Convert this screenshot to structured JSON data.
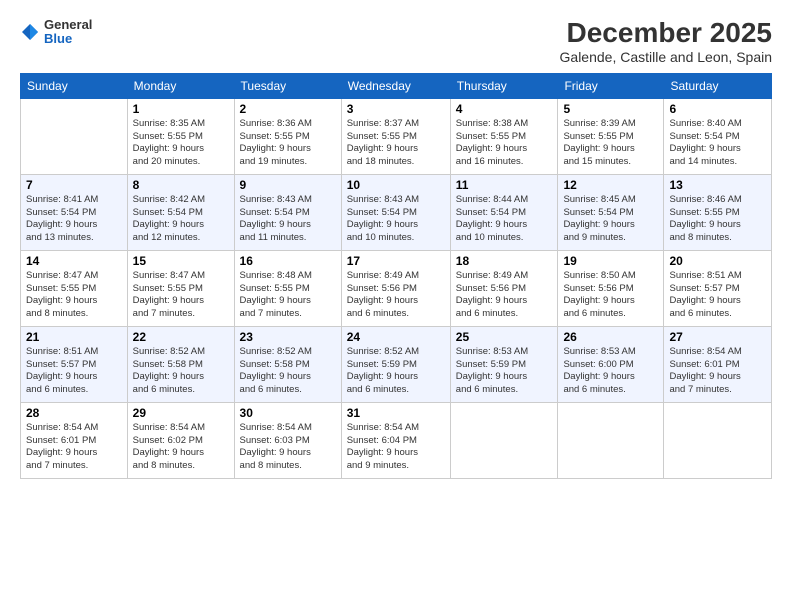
{
  "logo": {
    "general": "General",
    "blue": "Blue"
  },
  "title": "December 2025",
  "location": "Galende, Castille and Leon, Spain",
  "weekdays": [
    "Sunday",
    "Monday",
    "Tuesday",
    "Wednesday",
    "Thursday",
    "Friday",
    "Saturday"
  ],
  "weeks": [
    [
      {
        "day": "",
        "info": ""
      },
      {
        "day": "1",
        "info": "Sunrise: 8:35 AM\nSunset: 5:55 PM\nDaylight: 9 hours\nand 20 minutes."
      },
      {
        "day": "2",
        "info": "Sunrise: 8:36 AM\nSunset: 5:55 PM\nDaylight: 9 hours\nand 19 minutes."
      },
      {
        "day": "3",
        "info": "Sunrise: 8:37 AM\nSunset: 5:55 PM\nDaylight: 9 hours\nand 18 minutes."
      },
      {
        "day": "4",
        "info": "Sunrise: 8:38 AM\nSunset: 5:55 PM\nDaylight: 9 hours\nand 16 minutes."
      },
      {
        "day": "5",
        "info": "Sunrise: 8:39 AM\nSunset: 5:55 PM\nDaylight: 9 hours\nand 15 minutes."
      },
      {
        "day": "6",
        "info": "Sunrise: 8:40 AM\nSunset: 5:54 PM\nDaylight: 9 hours\nand 14 minutes."
      }
    ],
    [
      {
        "day": "7",
        "info": "Sunrise: 8:41 AM\nSunset: 5:54 PM\nDaylight: 9 hours\nand 13 minutes."
      },
      {
        "day": "8",
        "info": "Sunrise: 8:42 AM\nSunset: 5:54 PM\nDaylight: 9 hours\nand 12 minutes."
      },
      {
        "day": "9",
        "info": "Sunrise: 8:43 AM\nSunset: 5:54 PM\nDaylight: 9 hours\nand 11 minutes."
      },
      {
        "day": "10",
        "info": "Sunrise: 8:43 AM\nSunset: 5:54 PM\nDaylight: 9 hours\nand 10 minutes."
      },
      {
        "day": "11",
        "info": "Sunrise: 8:44 AM\nSunset: 5:54 PM\nDaylight: 9 hours\nand 10 minutes."
      },
      {
        "day": "12",
        "info": "Sunrise: 8:45 AM\nSunset: 5:54 PM\nDaylight: 9 hours\nand 9 minutes."
      },
      {
        "day": "13",
        "info": "Sunrise: 8:46 AM\nSunset: 5:55 PM\nDaylight: 9 hours\nand 8 minutes."
      }
    ],
    [
      {
        "day": "14",
        "info": "Sunrise: 8:47 AM\nSunset: 5:55 PM\nDaylight: 9 hours\nand 8 minutes."
      },
      {
        "day": "15",
        "info": "Sunrise: 8:47 AM\nSunset: 5:55 PM\nDaylight: 9 hours\nand 7 minutes."
      },
      {
        "day": "16",
        "info": "Sunrise: 8:48 AM\nSunset: 5:55 PM\nDaylight: 9 hours\nand 7 minutes."
      },
      {
        "day": "17",
        "info": "Sunrise: 8:49 AM\nSunset: 5:56 PM\nDaylight: 9 hours\nand 6 minutes."
      },
      {
        "day": "18",
        "info": "Sunrise: 8:49 AM\nSunset: 5:56 PM\nDaylight: 9 hours\nand 6 minutes."
      },
      {
        "day": "19",
        "info": "Sunrise: 8:50 AM\nSunset: 5:56 PM\nDaylight: 9 hours\nand 6 minutes."
      },
      {
        "day": "20",
        "info": "Sunrise: 8:51 AM\nSunset: 5:57 PM\nDaylight: 9 hours\nand 6 minutes."
      }
    ],
    [
      {
        "day": "21",
        "info": "Sunrise: 8:51 AM\nSunset: 5:57 PM\nDaylight: 9 hours\nand 6 minutes."
      },
      {
        "day": "22",
        "info": "Sunrise: 8:52 AM\nSunset: 5:58 PM\nDaylight: 9 hours\nand 6 minutes."
      },
      {
        "day": "23",
        "info": "Sunrise: 8:52 AM\nSunset: 5:58 PM\nDaylight: 9 hours\nand 6 minutes."
      },
      {
        "day": "24",
        "info": "Sunrise: 8:52 AM\nSunset: 5:59 PM\nDaylight: 9 hours\nand 6 minutes."
      },
      {
        "day": "25",
        "info": "Sunrise: 8:53 AM\nSunset: 5:59 PM\nDaylight: 9 hours\nand 6 minutes."
      },
      {
        "day": "26",
        "info": "Sunrise: 8:53 AM\nSunset: 6:00 PM\nDaylight: 9 hours\nand 6 minutes."
      },
      {
        "day": "27",
        "info": "Sunrise: 8:54 AM\nSunset: 6:01 PM\nDaylight: 9 hours\nand 7 minutes."
      }
    ],
    [
      {
        "day": "28",
        "info": "Sunrise: 8:54 AM\nSunset: 6:01 PM\nDaylight: 9 hours\nand 7 minutes."
      },
      {
        "day": "29",
        "info": "Sunrise: 8:54 AM\nSunset: 6:02 PM\nDaylight: 9 hours\nand 8 minutes."
      },
      {
        "day": "30",
        "info": "Sunrise: 8:54 AM\nSunset: 6:03 PM\nDaylight: 9 hours\nand 8 minutes."
      },
      {
        "day": "31",
        "info": "Sunrise: 8:54 AM\nSunset: 6:04 PM\nDaylight: 9 hours\nand 9 minutes."
      },
      {
        "day": "",
        "info": ""
      },
      {
        "day": "",
        "info": ""
      },
      {
        "day": "",
        "info": ""
      }
    ]
  ]
}
